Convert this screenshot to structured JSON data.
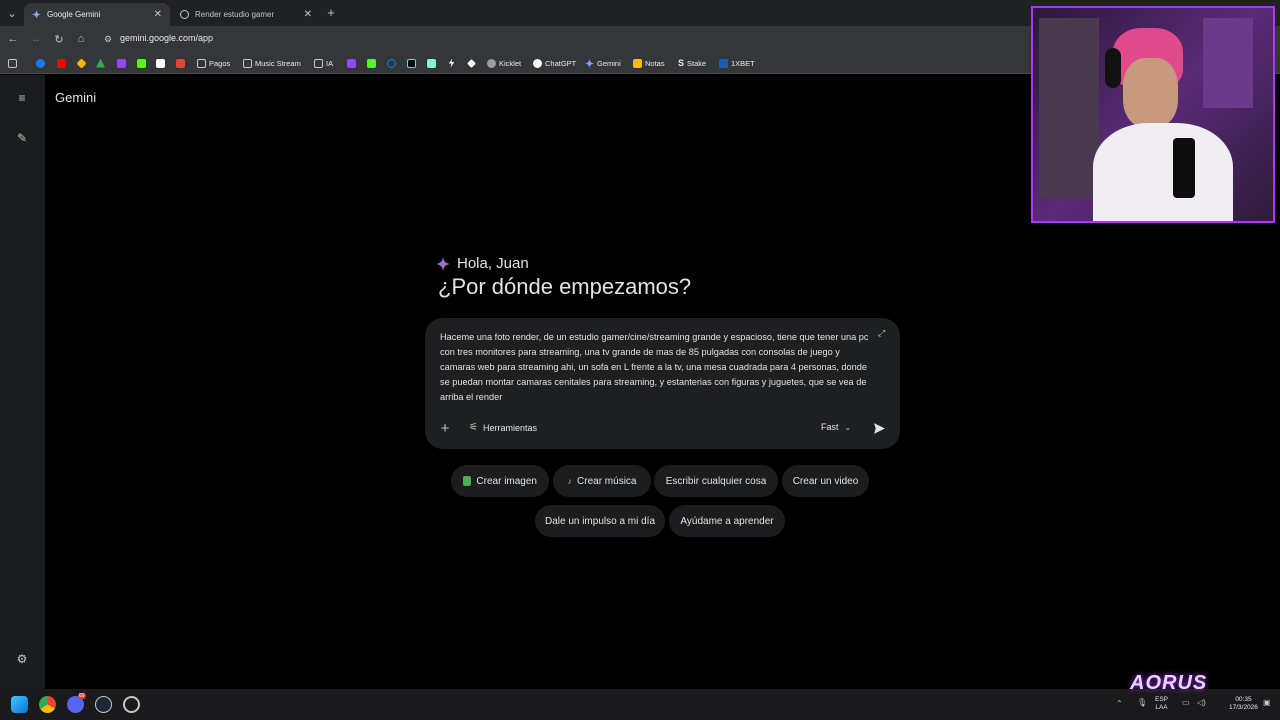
{
  "browser": {
    "tabs": [
      {
        "label": "Google Gemini",
        "active": true
      },
      {
        "label": "Render estudio gamer",
        "active": false
      }
    ],
    "url": "gemini.google.com/app",
    "bookmarks": [
      {
        "label": "Pagos",
        "icon": "folder-icon"
      },
      {
        "label": "Music Stream",
        "icon": "folder-icon"
      },
      {
        "label": "IA",
        "icon": "folder-icon"
      },
      {
        "label": "Kicklet",
        "icon": "kicklet-icon"
      },
      {
        "label": "ChatGPT",
        "icon": "chatgpt-icon"
      },
      {
        "label": "Gemini",
        "icon": "gemini-icon"
      },
      {
        "label": "Notas",
        "icon": "notes-icon"
      },
      {
        "label": "Stake",
        "icon": "stake-icon"
      },
      {
        "label": "1XBET",
        "icon": "1xbet-icon"
      }
    ]
  },
  "app": {
    "title": "Gemini",
    "greeting": "Hola, Juan",
    "headline": "¿Por dónde empezamos?",
    "prompt": "Haceme una foto render, de un estudio gamer/cine/streaming grande y espacioso, tiene que tener una pc con tres monitores para streaming, una tv grande de mas de 85 pulgadas con consolas de juego y camaras web para streaming ahi, un sofa en L frente a la tv, una mesa cuadrada para 4 personas, donde se puedan montar camaras cenitales para streaming, y estanterias con figuras y juguetes, que se vea de arriba el render",
    "tools_label": "Herramientas",
    "model_label": "Fast",
    "chips": [
      {
        "label": "Crear imagen",
        "icon": "image-emoji-icon"
      },
      {
        "label": "Crear música",
        "icon": "guitar-emoji-icon"
      },
      {
        "label": "Escribir cualquier cosa"
      },
      {
        "label": "Crear un video"
      },
      {
        "label": "Dale un impulso a mi día"
      },
      {
        "label": "Ayúdame a aprender"
      }
    ]
  },
  "taskbar": {
    "lang": "ESP",
    "lang2": "LAA",
    "time": "00:35",
    "date": "17/3/2026",
    "discord_badge": "69"
  },
  "overlay": {
    "brand": "AORUS"
  },
  "colors": {
    "accent_purple": "#b035ff",
    "card_bg": "#1e1f20",
    "rail_bg": "#1b1c1d"
  }
}
